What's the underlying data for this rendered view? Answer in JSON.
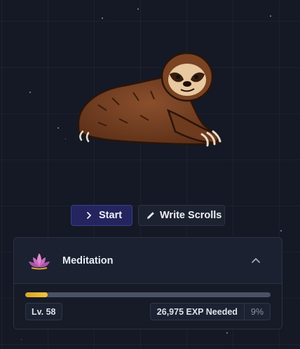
{
  "actions": {
    "start_label": "Start",
    "write_label": "Write Scrolls"
  },
  "skill": {
    "name": "Meditation",
    "icon": "lotus-icon",
    "level_label": "Lv. 58",
    "exp_needed_label": "26,975 EXP Needed",
    "progress_label": "9%",
    "progress_fraction": 0.09,
    "progress_color": "#e6b733"
  },
  "character": {
    "icon": "sloth-illustration"
  },
  "colors": {
    "background": "#141925",
    "start_button": "#24255e",
    "panel": "#1b2130"
  }
}
